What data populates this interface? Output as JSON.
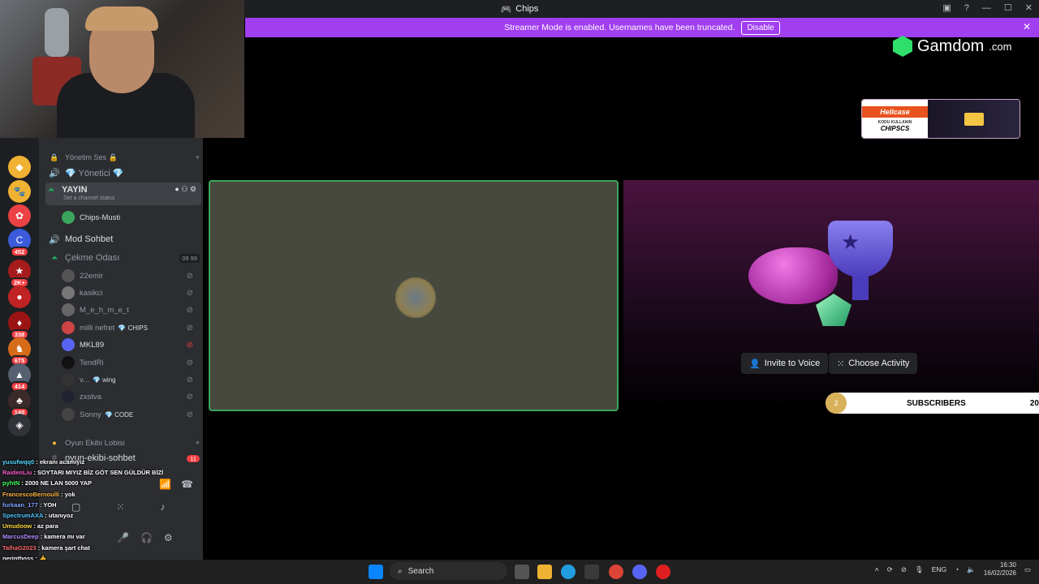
{
  "window": {
    "title": "Chips"
  },
  "banner": {
    "text": "Streamer Mode is enabled. Usernames have been truncated.",
    "disable_label": "Disable"
  },
  "server_badges": [
    "452",
    "2K+",
    "338",
    "675",
    "414",
    "140"
  ],
  "channels": {
    "category_top": "Yönetim Ses 🔒",
    "yonetici": "💎 Yönetici 💎",
    "yayin": "YAYIN",
    "yayin_status": "Set a channel status",
    "chips_musti": "Chips-Musti",
    "mod_sohbet": "Mod Sohbet",
    "cekme_odasi": "Çekme Odası",
    "cekme_count_a": "09",
    "cekme_count_b": "99",
    "members": [
      {
        "name": "22emir",
        "tag": ""
      },
      {
        "name": "kasikci",
        "tag": ""
      },
      {
        "name": "M_e_h_m_e_t",
        "tag": ""
      },
      {
        "name": "milli nefret",
        "tag": "💎 CHIPS"
      },
      {
        "name": "MKL89",
        "tag": ""
      },
      {
        "name": "TendRi",
        "tag": ""
      },
      {
        "name": "v...",
        "tag": "💎 wing"
      },
      {
        "name": "zxstva",
        "tag": ""
      },
      {
        "name": "Sonny",
        "tag": "💎 CODE"
      }
    ],
    "oyun_lobi": "Oyun Ekibi Lobisi",
    "oyun_sohbet": "oyun-ekibi-sohbet",
    "oyun_badge": "11"
  },
  "chat": [
    {
      "user": "yusufwqq0",
      "msg": "ekranı acamıyız",
      "color": "#55d8ff"
    },
    {
      "user": "RaidenLiu",
      "msg": "SOYTARI MIYIZ BİZ GÖT SEN GÜLDÜR BİZİ",
      "color": "#ff5bd1"
    },
    {
      "user": "pyhtN",
      "msg": "2000 NE LAN 5000 YAP",
      "color": "#3cff5d"
    },
    {
      "user": "FrancescoBernoulli",
      "msg": "yok",
      "color": "#ffb23f"
    },
    {
      "user": "furkaan_177",
      "msg": "YOH",
      "color": "#7fa2ff"
    },
    {
      "user": "SpectrumAXA",
      "msg": "utanıyoz",
      "color": "#4fc7ff"
    },
    {
      "user": "Umudoow",
      "msg": "az para",
      "color": "#ffd93f"
    },
    {
      "user": "MarcusDeep",
      "msg": "kamera mı var",
      "color": "#b58cff"
    },
    {
      "user": "TalhaG2023",
      "msg": "kamera şart chat",
      "color": "#ff6b6b"
    },
    {
      "user": "perinthoss",
      "msg": "👍",
      "color": "#ffffff"
    },
    {
      "user": "yigido190777",
      "msg": "2K NE AMK",
      "color": "#ffffff"
    }
  ],
  "voice": {
    "invite_label": "Invite to Voice",
    "activity_label": "Choose Activity"
  },
  "subs": {
    "count": "2",
    "label": "SUBSCRIBERS",
    "goal": "20"
  },
  "sponsor": {
    "gamdom": "Gamdom",
    "gamdom_tld": ".com",
    "hellcase": "Hellcase",
    "hell_sub": "KODU KULLANIN",
    "hell_code": "CHIPSCS"
  },
  "taskbar": {
    "search": "Search",
    "lang": "ENG",
    "time": "16:30",
    "date": "16/02/2026"
  },
  "colors": {
    "banner": "#a13ff0",
    "speaking": "#3ba55c",
    "bg": "#000000"
  }
}
